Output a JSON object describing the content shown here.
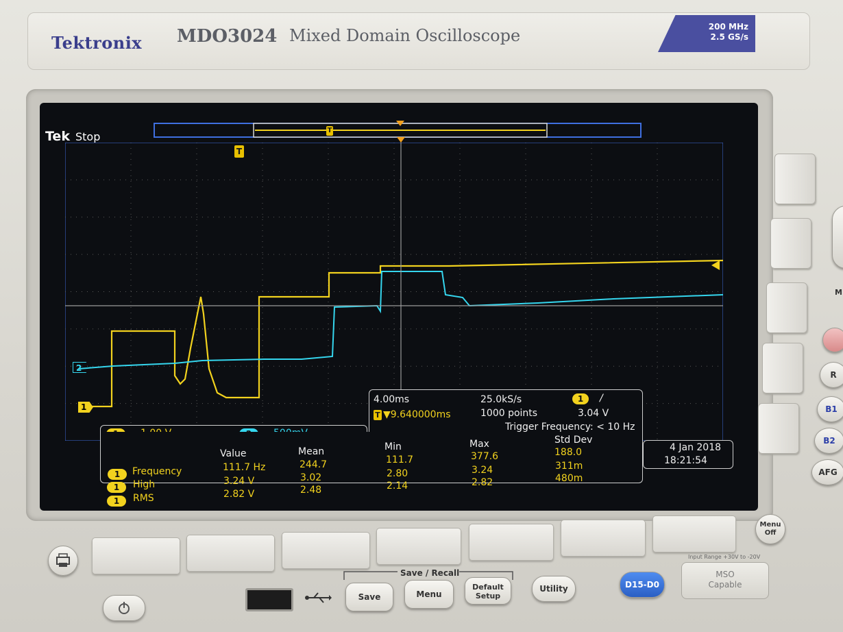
{
  "header": {
    "brand": "Tektronix",
    "model": "MDO3024",
    "description": "Mixed Domain Oscilloscope",
    "spec_line1": "200 MHz",
    "spec_line2": "2.5 GS/s"
  },
  "screen": {
    "tek_label": "Tek",
    "status": "Stop",
    "trigger_marker": "T",
    "ch1_marker": "1",
    "ch2_marker": "2",
    "channels": {
      "ch1_num": "1",
      "ch1_scale": "1.00 V",
      "ch2_num": "2",
      "ch2_scale": "500mV"
    },
    "timebase": {
      "horizontal_scale": "4.00ms",
      "sample_rate": "25.0kS/s",
      "trigger_channel": "1",
      "trigger_slope": "/",
      "delay_icon": "T",
      "delay": "▼9.640000ms",
      "record_length": "1000 points",
      "trigger_level": "3.04 V",
      "trigger_frequency": "Trigger Frequency: < 10 Hz"
    },
    "measurements": {
      "headers": [
        "Value",
        "Mean",
        "Min",
        "Max",
        "Std Dev"
      ],
      "rows": [
        {
          "ch": "1",
          "name": "Frequency",
          "value": "111.7 Hz",
          "mean": "244.7",
          "min": "111.7",
          "max": "377.6",
          "std": "188.0"
        },
        {
          "ch": "1",
          "name": "High",
          "value": "3.24 V",
          "mean": "3.02",
          "min": "2.80",
          "max": "3.24",
          "std": "311m"
        },
        {
          "ch": "1",
          "name": "RMS",
          "value": "2.82 V",
          "mean": "2.48",
          "min": "2.14",
          "max": "2.82",
          "std": "480m"
        }
      ]
    },
    "date": "4 Jan 2018",
    "time": "18:21:54"
  },
  "panel": {
    "group_label": "Save / Recall",
    "save": "Save",
    "menu": "Menu",
    "default_setup_1": "Default",
    "default_setup_2": "Setup",
    "utility": "Utility",
    "digital": "D15-D0",
    "mso_1": "MSO",
    "mso_2": "Capable",
    "input_range": "Input Range +30V to -20V",
    "menu_off_1": "Menu",
    "menu_off_2": "Off",
    "side_labels": [
      "M",
      "R",
      "B1",
      "B2",
      "AFG"
    ]
  },
  "colors": {
    "ch1": "#f2d21e",
    "ch2": "#35d6ee",
    "screen_bg": "#0c0e12",
    "brand": "#3a3e8c",
    "spec_badge": "#4a4fa0",
    "digital_btn": "#2f6fd8"
  },
  "icons": [
    "usb-icon",
    "power-icon",
    "print-icon"
  ]
}
